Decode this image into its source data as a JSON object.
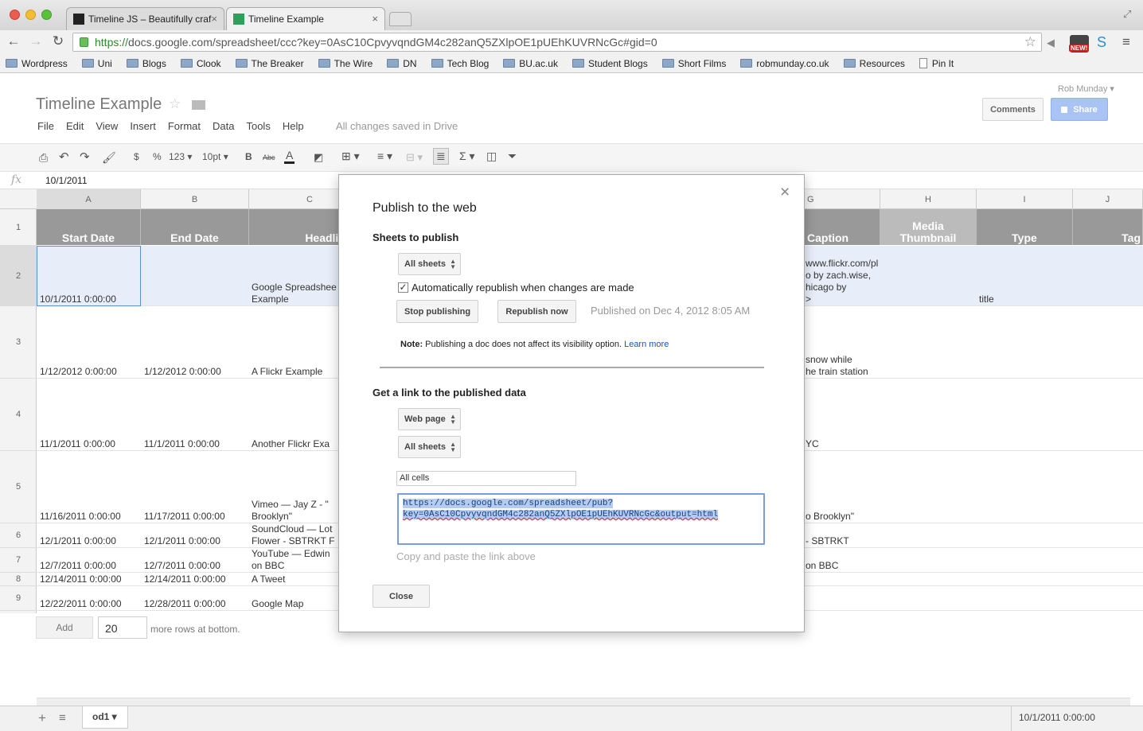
{
  "browser": {
    "tabs": [
      {
        "title": "Timeline JS – Beautifully craf"
      },
      {
        "title": "Timeline Example"
      }
    ],
    "url_secure": "https://",
    "url_rest": "docs.google.com/spreadsheet/ccc?key=0AsC10CpvyvqndGM4c282anQ5ZXlpOE1pUEhKUVRNcGc#gid=0",
    "badge": "NEW!",
    "bookmarks": [
      "Wordpress",
      "Uni",
      "Blogs",
      "Clook",
      "The Breaker",
      "The Wire",
      "DN",
      "Tech Blog",
      "BU.ac.uk",
      "Student Blogs",
      "Short Films",
      "robmunday.co.uk",
      "Resources",
      "Pin It"
    ]
  },
  "doc": {
    "title": "Timeline Example",
    "user": "Rob Munday",
    "menu": [
      "File",
      "Edit",
      "View",
      "Insert",
      "Format",
      "Data",
      "Tools",
      "Help"
    ],
    "saved_status": "All changes saved in Drive",
    "comments_label": "Comments",
    "share_label": "Share"
  },
  "toolbar": {
    "currency": "$",
    "percent": "%",
    "number": "123",
    "font_size": "10pt",
    "bold": "B",
    "strike": "Abc",
    "font_color": "A",
    "sigma": "Σ"
  },
  "formula": {
    "fx": "fx",
    "value": "10/1/2011"
  },
  "sheet": {
    "col_letters": [
      "A",
      "B",
      "C",
      "G",
      "H",
      "I",
      "J"
    ],
    "headers": [
      "Start Date",
      "End Date",
      "Headline",
      "Caption",
      "Media Thumbnail",
      "Type",
      "Tag"
    ],
    "row_numbers": [
      "1",
      "2",
      "3",
      "4",
      "5",
      "6",
      "7",
      "8",
      "9"
    ],
    "rows": [
      {
        "a": "10/1/2011 0:00:00",
        "b": "",
        "c": [
          "Google Spreadshee",
          "Example"
        ],
        "g": [
          "www.flickr.com/pl",
          "o by zach.wise,",
          "hicago by",
          ">"
        ],
        "i": "title"
      },
      {
        "a": "1/12/2012 0:00:00",
        "b": "1/12/2012 0:00:00",
        "c": [
          "A Flickr Example"
        ],
        "g": [
          "snow while",
          "he train station"
        ],
        "i": ""
      },
      {
        "a": "11/1/2011 0:00:00",
        "b": "11/1/2011 0:00:00",
        "c": [
          "Another Flickr Exa"
        ],
        "g": [
          "YC"
        ],
        "i": ""
      },
      {
        "a": "11/16/2011 0:00:00",
        "b": "11/17/2011 0:00:00",
        "c": [
          "Vimeo — Jay Z - \"",
          "Brooklyn\""
        ],
        "g": [
          "o Brooklyn\""
        ],
        "i": ""
      },
      {
        "a": "12/1/2011 0:00:00",
        "b": "12/1/2011 0:00:00",
        "c": [
          "SoundCloud — Lot",
          "Flower - SBTRKT F"
        ],
        "g": [
          "- SBTRKT"
        ],
        "i": ""
      },
      {
        "a": "12/7/2011 0:00:00",
        "b": "12/7/2011 0:00:00",
        "c": [
          "YouTube — Edwin",
          "on BBC"
        ],
        "g": [
          "on BBC"
        ],
        "i": ""
      },
      {
        "a": "12/14/2011 0:00:00",
        "b": "12/14/2011 0:00:00",
        "c": [
          "A Tweet"
        ],
        "g": [],
        "i": ""
      },
      {
        "a": "12/22/2011 0:00:00",
        "b": "12/28/2011 0:00:00",
        "c": [
          "Google Map"
        ],
        "g": [],
        "i": ""
      }
    ],
    "add_label": "Add",
    "add_count": "20",
    "more_rows_label": "more rows at bottom.",
    "sheet_tab": "od1",
    "status_value": "10/1/2011 0:00:00"
  },
  "dialog": {
    "title": "Publish to the web",
    "sheets_heading": "Sheets to publish",
    "sheets_select": "All sheets",
    "auto_republish": "Automatically republish when changes are made",
    "stop_btn": "Stop publishing",
    "republish_btn": "Republish now",
    "published_status": "Published on Dec 4, 2012 8:05 AM",
    "note_label": "Note:",
    "note_text": "Publishing a doc does not affect its visibility option.",
    "learn_more": "Learn more",
    "link_heading": "Get a link to the published data",
    "format_select": "Web page",
    "sheets_select2": "All sheets",
    "range_value": "All cells",
    "link_line1": "https://docs.google.com/spreadsheet/pub?",
    "link_line2": "key=0AsC10CpvyvqndGM4c282anQ5ZXlpOE1pUEhKUVRNcGc&output=html",
    "copy_hint": "Copy and paste the link above",
    "close_btn": "Close",
    "close_icon": "×"
  },
  "colors": {
    "header_gray": "#999999",
    "selection": "#e8eef9",
    "link_blue": "#1155cc",
    "share_blue": "#a9c4f4"
  }
}
